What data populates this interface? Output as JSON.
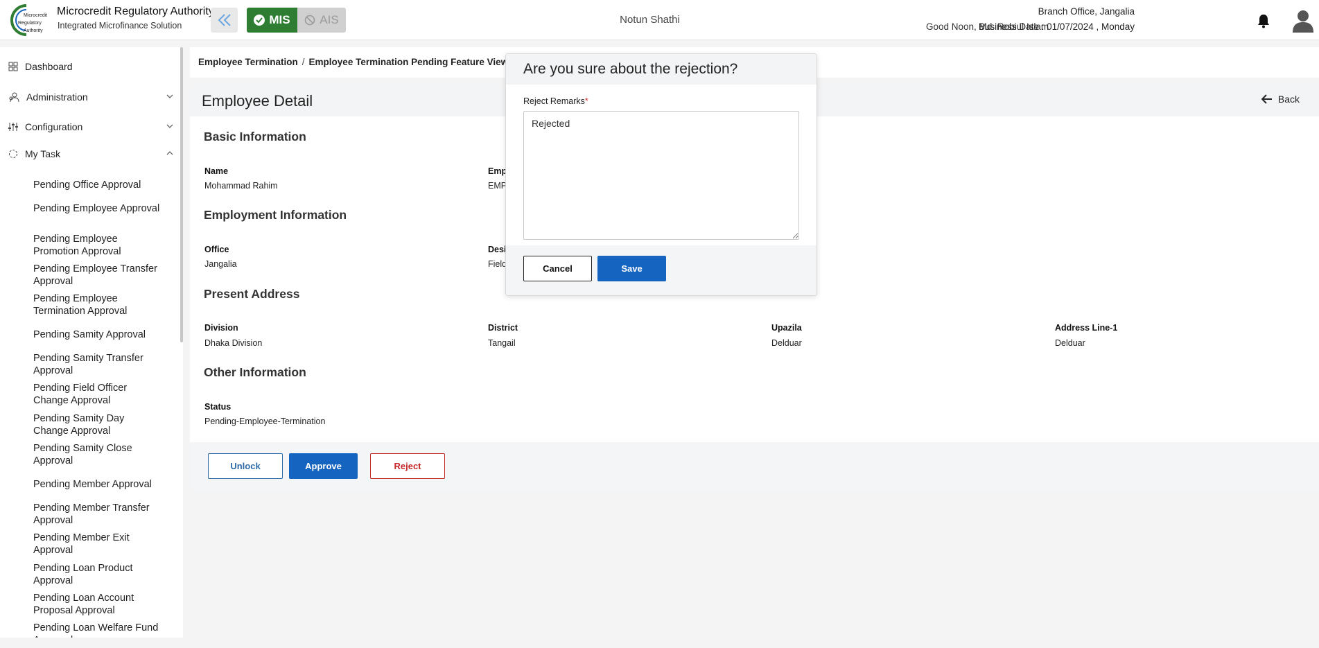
{
  "header": {
    "org_name": "Microcredit Regulatory Authority",
    "org_sub": "Integrated Microfinance Solution",
    "logo_text": [
      "Microcredit",
      "Regulatory",
      "Authority"
    ],
    "mis_label": "MIS",
    "ais_label": "AIS",
    "app_name": "Notun Shathi",
    "branch": "Branch Office, Jangalia",
    "greeting": "Good Noon, Md. Robiul Islam",
    "business_date": "Business Date : 01/07/2024 , Monday",
    "colors": {
      "mis": "#2e7d32",
      "primary": "#1565c0",
      "danger": "#c62828",
      "logo": "#2e7d32"
    }
  },
  "sidebar": {
    "items": [
      {
        "label": "Dashboard",
        "icon": "grid-icon"
      },
      {
        "label": "Administration",
        "icon": "admin-icon",
        "chevron": "chevron-down"
      },
      {
        "label": "Configuration",
        "icon": "sliders-icon",
        "chevron": "chevron-down"
      },
      {
        "label": "My Task",
        "icon": "task-icon",
        "chevron": "chevron-up"
      }
    ],
    "subitems": [
      "Pending Office Approval",
      "Pending Employee Approval",
      "Pending Employee Promotion Approval",
      "Pending Employee Transfer Approval",
      "Pending Employee Termination Approval",
      "Pending Samity Approval",
      "Pending Samity Transfer Approval",
      "Pending Field Officer Change Approval",
      "Pending Samity Day Change Approval",
      "Pending Samity Close Approval",
      "Pending Member Approval",
      "Pending Member Transfer Approval",
      "Pending Member Exit Approval",
      "Pending Loan Product Approval",
      "Pending Loan Account Proposal Approval",
      "Pending Loan Welfare Fund Approval"
    ]
  },
  "breadcrumb": {
    "parent": "Employee Termination",
    "separator": "/",
    "current": "Employee Termination Pending Feature View"
  },
  "page": {
    "title": "Employee Detail",
    "back_label": "Back"
  },
  "sections": {
    "basic": {
      "title": "Basic Information",
      "name_label": "Name",
      "name_value": "Mohammad Rahim",
      "emp_label": "Emp",
      "emp_value": "EMP"
    },
    "employment": {
      "title": "Employment Information",
      "office_label": "Office",
      "office_value": "Jangalia",
      "desig_label": "Desi",
      "desig_value": "Field"
    },
    "address": {
      "title": "Present Address",
      "division_label": "Division",
      "division_value": "Dhaka Division",
      "district_label": "District",
      "district_value": "Tangail",
      "upazila_label": "Upazila",
      "upazila_value": "Delduar",
      "line1_label": "Address Line-1",
      "line1_value": "Delduar"
    },
    "other": {
      "title": "Other Information",
      "status_label": "Status",
      "status_value": "Pending-Employee-Termination"
    }
  },
  "actions": {
    "unlock": "Unlock",
    "approve": "Approve",
    "reject": "Reject"
  },
  "modal": {
    "title": "Are you sure about the rejection?",
    "label": "Reject Remarks",
    "required_mark": "*",
    "remarks_value": "Rejected",
    "cancel": "Cancel",
    "save": "Save"
  }
}
